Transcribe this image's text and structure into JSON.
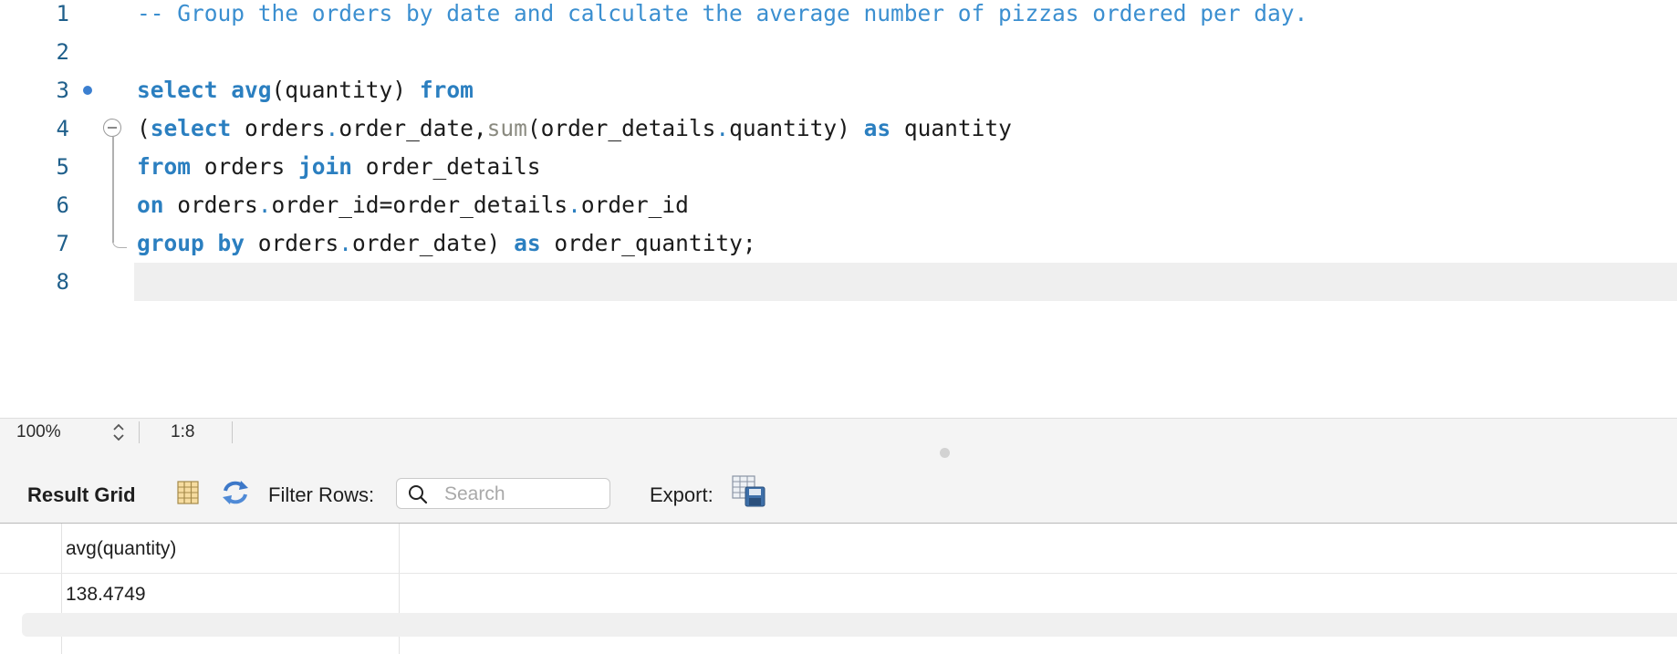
{
  "editor": {
    "line_numbers": [
      "1",
      "2",
      "3",
      "4",
      "5",
      "6",
      "7",
      "8"
    ],
    "lines": {
      "l1": {
        "comment": "-- Group the orders by date and calculate the average number of pizzas ordered per day."
      },
      "l3": {
        "kw_select": "select",
        "fn_avg": "avg",
        "args": "(quantity) ",
        "kw_from": "from"
      },
      "l4": {
        "open": "(",
        "kw_select": "select",
        "t1": " orders",
        "d1": ".",
        "t2": "order_date,",
        "fn_sum": "sum",
        "t3": "(order_details",
        "d2": ".",
        "t4": "quantity) ",
        "kw_as": "as",
        "t5": " quantity"
      },
      "l5": {
        "kw_from": "from",
        "t1": " orders ",
        "kw_join": "join",
        "t2": " order_details"
      },
      "l6": {
        "kw_on": "on",
        "t1": " orders",
        "d1": ".",
        "t2": "order_id",
        "op": "=",
        "t3": "order_details",
        "d2": ".",
        "t4": "order_id"
      },
      "l7": {
        "kw_group": "group by",
        "t1": " orders",
        "d1": ".",
        "t2": "order_date) ",
        "kw_as": "as",
        "t3": " order_quantity;"
      }
    }
  },
  "statusbar": {
    "zoom": "100%",
    "cursor": "1:8"
  },
  "results": {
    "title": "Result Grid",
    "filter_label": "Filter Rows:",
    "search_placeholder": "Search",
    "search_value": "",
    "export_label": "Export:",
    "columns": [
      "avg(quantity)"
    ],
    "rows": [
      [
        "138.4749"
      ]
    ]
  },
  "icons": {
    "breakpoint": "breakpoint-dot-icon",
    "fold": "fold-collapse-icon",
    "grid_columns": "grid-columns-icon",
    "refresh": "refresh-icon",
    "search": "search-icon",
    "export": "export-save-icon"
  },
  "colors": {
    "keyword": "#2b7fc0",
    "comment": "#3b8fd0",
    "builtin_fn": "#8a8a80",
    "line_number": "#1f5f8b",
    "current_line": "#efefef"
  }
}
